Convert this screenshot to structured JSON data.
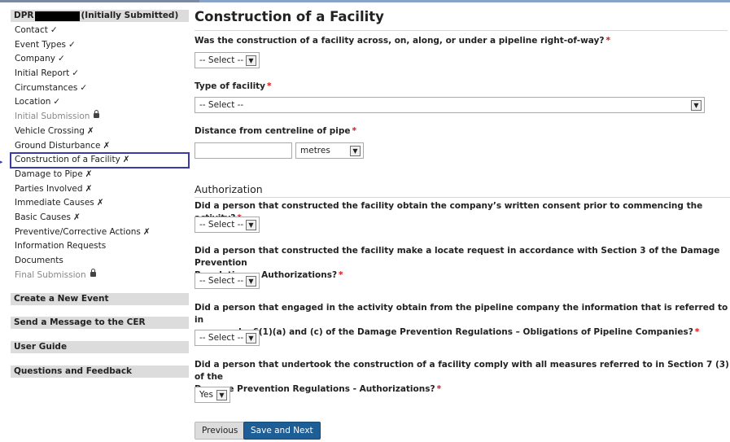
{
  "sidebar": {
    "header": {
      "prefix": "DPR",
      "status": "(Initially Submitted)"
    },
    "items": [
      {
        "label": "Contact",
        "mark": "✓"
      },
      {
        "label": "Event Types",
        "mark": "✓"
      },
      {
        "label": "Company",
        "mark": "✓"
      },
      {
        "label": "Initial Report",
        "mark": "✓"
      },
      {
        "label": "Circumstances",
        "mark": "✓"
      },
      {
        "label": "Location",
        "mark": "✓"
      },
      {
        "label": "Initial Submission",
        "mark": ""
      },
      {
        "label": "Vehicle Crossing",
        "mark": "✗"
      },
      {
        "label": "Ground Disturbance",
        "mark": "✗"
      },
      {
        "label": "Construction of a Facility",
        "mark": "✗"
      },
      {
        "label": "Damage to Pipe",
        "mark": "✗"
      },
      {
        "label": "Parties Involved",
        "mark": "✗"
      },
      {
        "label": "Immediate Causes",
        "mark": "✗"
      },
      {
        "label": "Basic Causes",
        "mark": "✗"
      },
      {
        "label": "Preventive/Corrective Actions",
        "mark": "✗"
      },
      {
        "label": "Information Requests",
        "mark": ""
      },
      {
        "label": "Documents",
        "mark": ""
      },
      {
        "label": "Final Submission",
        "mark": ""
      }
    ],
    "links": {
      "new_event": "Create a New Event",
      "message": "Send a Message to the CER",
      "guide": "User Guide",
      "feedback": "Questions and Feedback"
    }
  },
  "main": {
    "title": "Construction of a Facility",
    "q1": {
      "label": "Was the construction of a facility across, on, along, or under a pipeline right-of-way?",
      "value": "-- Select --"
    },
    "q2": {
      "label": "Type of facility",
      "value": "-- Select --"
    },
    "q3": {
      "label": "Distance from centreline of pipe",
      "value": "",
      "unit": "metres"
    },
    "auth": {
      "title": "Authorization",
      "a1": {
        "label": "Did a person that constructed the facility obtain the company’s written consent prior to commencing the activity?",
        "value": "-- Select --"
      },
      "a2": {
        "line1": "Did a person that constructed the facility make a locate request in accordance with Section 3 of the Damage Prevention",
        "line2": "Regulations - Authorizations?",
        "value": "-- Select --"
      },
      "a3": {
        "line1": "Did a person that engaged in the activity obtain from the pipeline company the information that is referred to in",
        "line2": "paragraphs 6(1)(a) and (c) of the Damage Prevention Regulations – Obligations of Pipeline Companies?",
        "value": "-- Select --"
      },
      "a4": {
        "line1": "Did a person that undertook the construction of a facility comply with all measures referred to in Section 7 (3) of the",
        "line2": "Damage Prevention Regulations - Authorizations?",
        "value": "Yes"
      }
    },
    "buttons": {
      "previous": "Previous",
      "save_next": "Save and Next"
    },
    "required": "*"
  },
  "colors": {
    "accent": "#1d5e97",
    "required": "#d01818",
    "active_outline": "#3a3aa8"
  }
}
